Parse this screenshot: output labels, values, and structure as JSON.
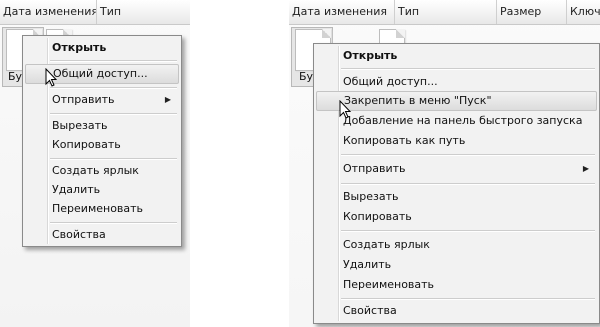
{
  "left": {
    "header": {
      "col_modified": "Дата изменения",
      "col_type": "Тип"
    },
    "file": {
      "name": "Бу"
    },
    "menu": {
      "open": "Открыть",
      "share": "Общий доступ...",
      "send_to": "Отправить",
      "cut": "Вырезать",
      "copy": "Копировать",
      "create_shortcut": "Создать ярлык",
      "delete": "Удалить",
      "rename": "Переименовать",
      "properties": "Свойства"
    }
  },
  "right": {
    "header": {
      "col_modified": "Дата изменения",
      "col_type": "Тип",
      "col_size": "Размер",
      "col_key": "Ключ"
    },
    "file": {
      "name": "Бу"
    },
    "menu": {
      "open": "Открыть",
      "share": "Общий доступ...",
      "pin_start": "Закрепить в меню \"Пуск\"",
      "add_quicklaunch": "Добавление на панель быстрого запуска",
      "copy_as_path": "Копировать как путь",
      "send_to": "Отправить",
      "cut": "Вырезать",
      "copy": "Копировать",
      "create_shortcut": "Создать ярлык",
      "delete": "Удалить",
      "rename": "Переименовать",
      "properties": "Свойства"
    }
  },
  "icons": {
    "submenu_arrow": "▶"
  }
}
